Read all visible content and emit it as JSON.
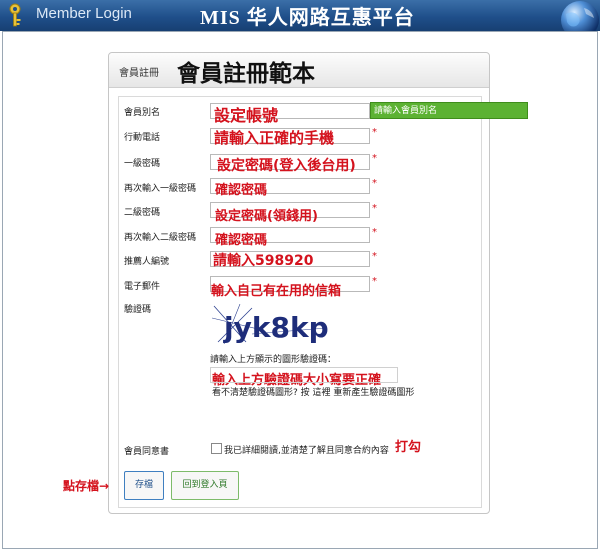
{
  "header": {
    "login_label": "Member Login",
    "site_title": "MIS 华人网路互惠平台"
  },
  "panel": {
    "small_title": "會員註冊",
    "big_title": "會員註冊範本"
  },
  "form": {
    "alias_label": "會員別名",
    "alias_annotation": "設定帳號",
    "alias_tip": "請輸入會員別名",
    "phone_label": "行動電話",
    "phone_annotation": "請輸入正確的手機",
    "pw1_label": "一級密碼",
    "pw1_annotation": "設定密碼(登入後台用)",
    "pw1_confirm_label": "再次輸入一級密碼",
    "pw1_confirm_annotation": "確認密碼",
    "pw2_label": "二級密碼",
    "pw2_annotation": "設定密碼(領錢用)",
    "pw2_confirm_label": "再次輸入二級密碼",
    "pw2_confirm_annotation": "確認密碼",
    "referrer_label": "推薦人編號",
    "referrer_annotation": "請輸入598920",
    "email_label": "電子郵件",
    "email_annotation": "輸入自己有在用的信箱",
    "captcha_label": "驗證碼",
    "captcha_text": "jyk8kp",
    "captcha_hint": "請輸入上方顯示的圖形驗證碼：",
    "captcha_annotation": "輸入上方驗證碼大小寫要正確",
    "captcha_refresh": "看不清楚驗證碼圖形? 按 這裡 重新產生驗證碼圖形",
    "agree_label": "會員同意書",
    "agree_text": "我已詳細閱讀,並清楚了解且同意合約內容",
    "agree_annotation": "打勾",
    "star": "*"
  },
  "buttons": {
    "save": "存檔",
    "back": "回到登入頁",
    "save_annotation": "點存檔→"
  },
  "colors": {
    "header_blue": "#1f4f8a",
    "annotation_red": "#d4121d",
    "tip_green": "#5cb233"
  }
}
